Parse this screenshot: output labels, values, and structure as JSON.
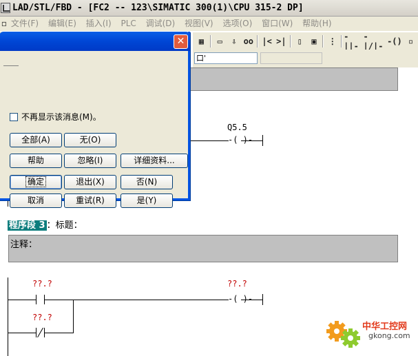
{
  "window": {
    "title": "LAD/STL/FBD  - [FC2 -- 123\\SIMATIC 300(1)\\CPU 315-2 DP]"
  },
  "menu": {
    "items": [
      "文件(F)",
      "编辑(E)",
      "插入(I)",
      "PLC",
      "调试(D)",
      "视图(V)",
      "选项(O)",
      "窗口(W)",
      "帮助(H)"
    ]
  },
  "toolbar": {
    "buttons": [
      "|<",
      ">|",
      "-||-",
      "-|/|-",
      "-()"
    ],
    "combo_value": "口'"
  },
  "dialog": {
    "checkbox_label": "不再显示该消息(M)。",
    "checkbox_checked": false,
    "buttons": {
      "all": "全部(A)",
      "none": "无(O)",
      "help": "帮助",
      "ignore": "忽略(I)",
      "details": "详细资料...",
      "ok": "确定",
      "exit": "退出(X)",
      "no": "否(N)",
      "cancel": "取消",
      "retry": "重试(R)",
      "yes": "是(Y)"
    }
  },
  "network2": {
    "coil_address": "Q5.5"
  },
  "network3": {
    "label": "程序段 3",
    "title": "：标题：",
    "comment": "注释：",
    "contact1_address": "??.?",
    "contact2_address": "??.?",
    "coil_address": "??.?"
  },
  "watermark": {
    "text": "中华工控网",
    "url": "gkong.com"
  }
}
